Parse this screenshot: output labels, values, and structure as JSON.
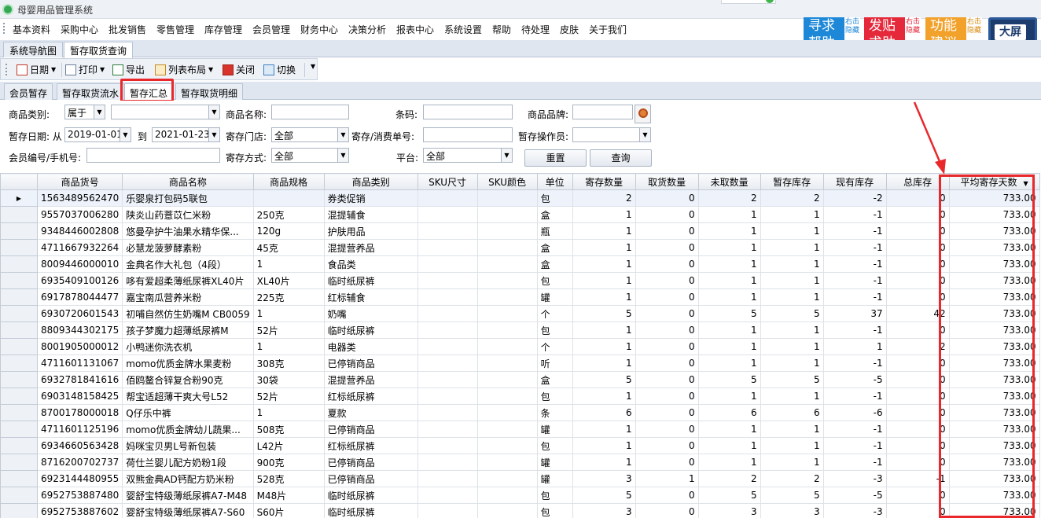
{
  "window": {
    "title": "母婴用品管理系统"
  },
  "menu": [
    "基本资料",
    "采购中心",
    "批发销售",
    "零售管理",
    "库存管理",
    "会员管理",
    "财务中心",
    "决策分析",
    "报表中心",
    "系统设置",
    "帮助",
    "待处理",
    "皮肤",
    "关于我们"
  ],
  "biz_buttons": [
    {
      "label": "寻求\n帮助",
      "side": "右击隐藏",
      "color": "#1d88d8"
    },
    {
      "label": "发贴\n求助",
      "side": "右击隐藏",
      "color": "#e5283a"
    },
    {
      "label": "功能\n建议",
      "side": "右击隐藏",
      "color": "#f2a12a"
    }
  ],
  "big_screen": {
    "label": "大屏"
  },
  "main_tabs": [
    "系统导航图",
    "暂存取货查询"
  ],
  "toolbar": {
    "date": "日期",
    "print": "打印",
    "export": "导出",
    "layout": "列表布局",
    "close": "关闭",
    "switch": "切换"
  },
  "sub_tabs": [
    "会员暂存",
    "暂存取货流水",
    "暂存汇总",
    "暂存取货明细"
  ],
  "filters": {
    "category_label": "商品类别:",
    "category_mode": "属于",
    "category_value": "",
    "name_label": "商品名称:",
    "name_value": "",
    "barcode_label": "条码:",
    "barcode_value": "",
    "brand_label": "商品品牌:",
    "brand_value": "",
    "date_label": "暂存日期: 从",
    "date_from": "2019-01-01",
    "date_to_label": "到",
    "date_to": "2021-01-23",
    "store_label": "寄存门店:",
    "store_value": "全部",
    "order_label": "寄存/消费单号:",
    "order_value": "",
    "operator_label": "暂存操作员:",
    "operator_value": "",
    "member_label": "会员编号/手机号:",
    "member_value": "",
    "method_label": "寄存方式:",
    "method_value": "全部",
    "platform_label": "平台:",
    "platform_value": "全部",
    "reset": "重置",
    "query": "查询"
  },
  "table": {
    "headers": [
      "商品货号",
      "商品名称",
      "商品规格",
      "商品类别",
      "SKU尺寸",
      "SKU颜色",
      "单位",
      "寄存数量",
      "取货数量",
      "未取数量",
      "暂存库存",
      "现有库存",
      "总库存",
      "平均寄存天数"
    ],
    "rows": [
      [
        "1563489562470",
        "乐婴泉打包码5联包",
        "",
        "券类促销",
        "",
        "",
        "包",
        "2",
        "0",
        "2",
        "2",
        "-2",
        "0",
        "733.00"
      ],
      [
        "9557037006280",
        "陕炎山药薏苡仁米粉",
        "250克",
        "混提辅食",
        "",
        "",
        "盒",
        "1",
        "0",
        "1",
        "1",
        "-1",
        "0",
        "733.00"
      ],
      [
        "9348446002808",
        "悠曼孕护牛油果水精华保...",
        "120g",
        "护肤用品",
        "",
        "",
        "瓶",
        "1",
        "0",
        "1",
        "1",
        "-1",
        "0",
        "733.00"
      ],
      [
        "4711667932264",
        "必慧龙菠萝酵素粉",
        "45克",
        "混提营养品",
        "",
        "",
        "盒",
        "1",
        "0",
        "1",
        "1",
        "-1",
        "0",
        "733.00"
      ],
      [
        "8009446000010",
        "金典名作大礼包（4段）",
        "1",
        "食品类",
        "",
        "",
        "盒",
        "1",
        "0",
        "1",
        "1",
        "-1",
        "0",
        "733.00"
      ],
      [
        "6935409100126",
        "哆有爱超柔薄纸尿裤XL40片",
        "XL40片",
        "临时纸尿裤",
        "",
        "",
        "包",
        "1",
        "0",
        "1",
        "1",
        "-1",
        "0",
        "733.00"
      ],
      [
        "6917878044477",
        "嘉宝南瓜营养米粉",
        "225克",
        "红标辅食",
        "",
        "",
        "罐",
        "1",
        "0",
        "1",
        "1",
        "-1",
        "0",
        "733.00"
      ],
      [
        "6930720601543",
        "初哺自然仿生奶嘴M CB0059",
        "1",
        "奶嘴",
        "",
        "",
        "个",
        "5",
        "0",
        "5",
        "5",
        "37",
        "42",
        "733.00"
      ],
      [
        "8809344302175",
        "孩子梦魔力超薄纸尿裤M",
        "52片",
        "临时纸尿裤",
        "",
        "",
        "包",
        "1",
        "0",
        "1",
        "1",
        "-1",
        "0",
        "733.00"
      ],
      [
        "8001905000012",
        "小鸭迷你洗衣机",
        "1",
        "电器类",
        "",
        "",
        "个",
        "1",
        "0",
        "1",
        "1",
        "1",
        "2",
        "733.00"
      ],
      [
        "4711601131067",
        "momo优质金牌水果麦粉",
        "308克",
        "已停销商品",
        "",
        "",
        "听",
        "1",
        "0",
        "1",
        "1",
        "-1",
        "0",
        "733.00"
      ],
      [
        "6932781841616",
        "佰鸥鳌合锌复合粉90克",
        "30袋",
        "混提营养品",
        "",
        "",
        "盒",
        "5",
        "0",
        "5",
        "5",
        "-5",
        "0",
        "733.00"
      ],
      [
        "6903148158425",
        "帮宝适超薄干爽大号L52",
        "52片",
        "红标纸尿裤",
        "",
        "",
        "包",
        "1",
        "0",
        "1",
        "1",
        "-1",
        "0",
        "733.00"
      ],
      [
        "8700178000018",
        "Q仔乐中裤",
        "1",
        "夏款",
        "",
        "",
        "条",
        "6",
        "0",
        "6",
        "6",
        "-6",
        "0",
        "733.00"
      ],
      [
        "4711601125196",
        "momo优质金牌幼儿蔬果...",
        "508克",
        "已停销商品",
        "",
        "",
        "罐",
        "1",
        "0",
        "1",
        "1",
        "-1",
        "0",
        "733.00"
      ],
      [
        "6934660563428",
        "妈咪宝贝男L号新包装",
        "L42片",
        "红标纸尿裤",
        "",
        "",
        "包",
        "1",
        "0",
        "1",
        "1",
        "-1",
        "0",
        "733.00"
      ],
      [
        "8716200702737",
        "荷仕兰婴儿配方奶粉1段",
        "900克",
        "已停销商品",
        "",
        "",
        "罐",
        "1",
        "0",
        "1",
        "1",
        "-1",
        "0",
        "733.00"
      ],
      [
        "6923144480955",
        "双熊金典AD钙配方奶米粉",
        "528克",
        "已停销商品",
        "",
        "",
        "罐",
        "3",
        "1",
        "2",
        "2",
        "-3",
        "-1",
        "733.00"
      ],
      [
        "6952753887480",
        "婴舒宝特级薄纸尿裤A7-M48",
        "M48片",
        "临时纸尿裤",
        "",
        "",
        "包",
        "5",
        "0",
        "5",
        "5",
        "-5",
        "0",
        "733.00"
      ],
      [
        "6952753887602",
        "婴舒宝特级薄纸尿裤A7-S60",
        "S60片",
        "临时纸尿裤",
        "",
        "",
        "包",
        "3",
        "0",
        "3",
        "3",
        "-3",
        "0",
        "733.00"
      ]
    ]
  }
}
